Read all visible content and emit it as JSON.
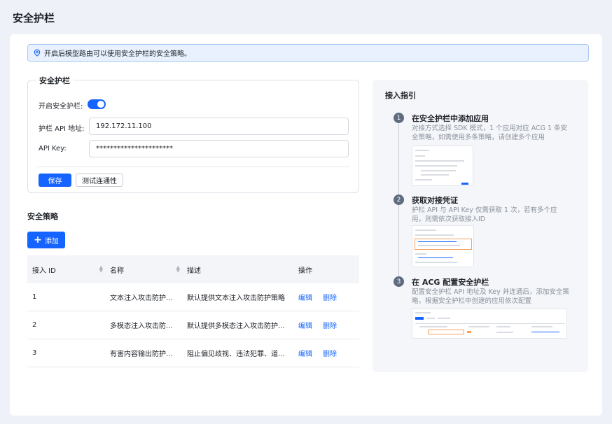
{
  "page": {
    "title": "安全护栏"
  },
  "alert": {
    "text": "开启后模型路由可以使用安全护栏的安全策略。"
  },
  "guardrail": {
    "legend": "安全护栏",
    "enable_label": "开启安全护栏:",
    "enabled": true,
    "api_label": "护栏 API 地址:",
    "api_value": "192.172.11.100",
    "key_label": "API Key:",
    "key_value": "**********************",
    "save_label": "保存",
    "test_label": "测试连通性"
  },
  "policies": {
    "title": "安全策略",
    "add_label": "添加",
    "columns": [
      "接入 ID",
      "名称",
      "描述",
      "操作"
    ],
    "rows": [
      {
        "id": "1",
        "name": "文本注入攻击防护策略",
        "desc": "默认提供文本注入攻击防护策略",
        "edit": "编辑",
        "delete": "删除"
      },
      {
        "id": "2",
        "name": "多模态注入攻击防护…",
        "desc": "默认提供多模态注入攻击防护策略",
        "edit": "编辑",
        "delete": "删除"
      },
      {
        "id": "3",
        "name": "有害内容输出防护策略",
        "desc": "阻止偏见歧视、违法犯罪、道德…",
        "edit": "编辑",
        "delete": "删除"
      }
    ]
  },
  "guide": {
    "title": "接入指引",
    "steps": [
      {
        "num": "1",
        "title": "在安全护栏中添加应用",
        "desc": "对接方式选择 SDK 模式，1 个应用对应 ACG 1 条安全策略，如需使用多条策略，请创建多个应用"
      },
      {
        "num": "2",
        "title": "获取对接凭证",
        "desc": "护栏 API 与 API Key 仅需获取 1 次，若有多个应用，则需依次获取接入ID"
      },
      {
        "num": "3",
        "title": "在 ACG 配置安全护栏",
        "desc": "配置安全护栏 API 地址及 Key 并连通后，添加安全策略，根据安全护栏中创建的应用依次配置"
      }
    ]
  },
  "colors": {
    "primary": "#1664ff",
    "alert_bg": "#e8f1fd",
    "alert_border": "#a9c8f5"
  },
  "icons": {
    "alert": "location-pin-icon",
    "add": "plus-icon",
    "sort": "sort-icon"
  }
}
